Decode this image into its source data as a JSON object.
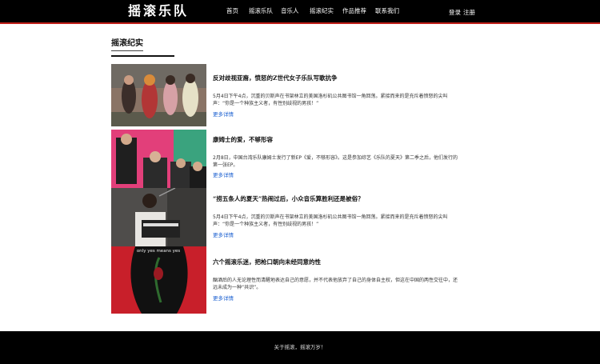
{
  "header": {
    "logo": "摇滚乐队",
    "nav": [
      "首页",
      "摇滚乐队",
      "音乐人",
      "摇滚纪实",
      "作品推荐",
      "联系我们"
    ],
    "auth": {
      "login": "登录",
      "register": "注册"
    }
  },
  "section": {
    "title": "摇滚纪实"
  },
  "articles": [
    {
      "title": "反对歧视亚裔，愤怒的Z世代女子乐队写歌抗争",
      "summary": "5月4日下午4点，沉重的贝斯声在书架林立的美国洛杉矶公共图书馆一角回荡。紧接而来的是充斥着愤怒的尖叫声：“你是一个种族主义者，有性别歧视的男孩！”",
      "more": "更多详情"
    },
    {
      "title": "康姆士的爱，不够形容",
      "summary": "2月8日，中国台湾乐队康姆士发行了新EP《爱，不够形容》。这是参加综艺《乐队的夏天》第二季之后，他们发行的第一张EP。",
      "more": "更多详情"
    },
    {
      "title": "“捞五条人的夏天”热闹过后，小众音乐算胜利还是被俗？",
      "summary": "5月4日下午4点，沉重的贝斯声在书架林立的美国洛杉矶公共图书馆一角回荡。紧接而来的是充斥着愤怒的尖叫声：“你是一个种族主义者，有性别歧视的男孩！”",
      "more": "更多详情"
    },
    {
      "title": "六个摇滚乐迷，把枪口朝向未经同意的性",
      "summary": "酗酒后的人无论理性而清醒地表达自己的意愿，并不代表他放弃了自己的身体自主权，但这在中国的两性交往中，还远未成为一种“共识”。",
      "more": "更多详情",
      "image_text": "only yes means yes"
    }
  ],
  "footer": {
    "text": "关于摇滚，摇滚万岁！"
  },
  "colors": {
    "accent": "#c0201a",
    "link": "#1a5fd0",
    "bar": "#000000"
  }
}
